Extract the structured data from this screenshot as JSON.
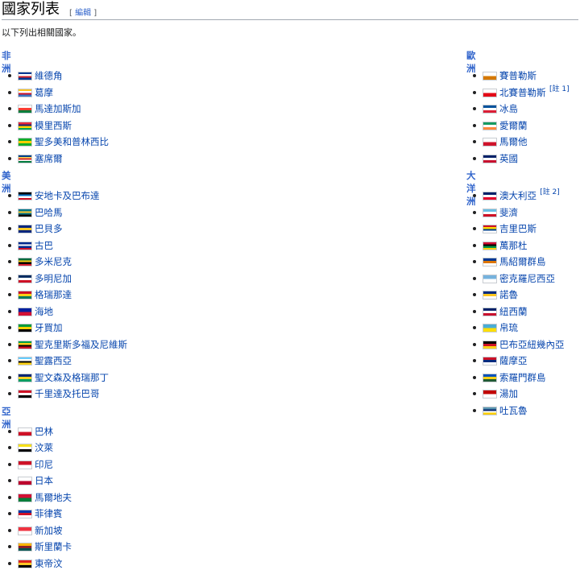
{
  "heading": {
    "title": "國家列表",
    "edit_open": "[",
    "edit_label": "編輯",
    "edit_close": "]"
  },
  "intro": "以下列出相關國家。",
  "left": [
    {
      "name": "非洲",
      "items": [
        {
          "name": "維德角",
          "flag": [
            "#003893",
            "#ffffff",
            "#cf2027",
            "#003893"
          ]
        },
        {
          "name": "葛摩",
          "flag": [
            "#ffc61e",
            "#ffffff",
            "#ce1126",
            "#3a75c4"
          ]
        },
        {
          "name": "馬達加斯加",
          "flag": [
            "#ffffff",
            "#fc3d32",
            "#007e3a"
          ]
        },
        {
          "name": "模里西斯",
          "flag": [
            "#ea2839",
            "#1a206d",
            "#ffd500",
            "#00a551"
          ]
        },
        {
          "name": "聖多美和普林西比",
          "flag": [
            "#12ad2b",
            "#ffce00",
            "#12ad2b"
          ]
        },
        {
          "name": "塞席爾",
          "flag": [
            "#003f87",
            "#fcd856",
            "#d62828",
            "#ffffff",
            "#007a3d"
          ]
        }
      ]
    },
    {
      "name": "美洲",
      "items": [
        {
          "name": "安地卡及巴布達",
          "flag": [
            "#000000",
            "#0072c6",
            "#ffffff",
            "#ce1126"
          ]
        },
        {
          "name": "巴哈馬",
          "flag": [
            "#00778b",
            "#ffc72c",
            "#00778b",
            "#000000"
          ]
        },
        {
          "name": "巴貝多",
          "flag": [
            "#00267f",
            "#ffc726",
            "#00267f"
          ]
        },
        {
          "name": "古巴",
          "flag": [
            "#002a8f",
            "#ffffff",
            "#002a8f",
            "#cf142b"
          ]
        },
        {
          "name": "多米尼克",
          "flag": [
            "#006b3f",
            "#fcd116",
            "#000000",
            "#d41c30"
          ]
        },
        {
          "name": "多明尼加",
          "flag": [
            "#002d62",
            "#ffffff",
            "#ce1126"
          ]
        },
        {
          "name": "格瑞那達",
          "flag": [
            "#ce1126",
            "#fcd116",
            "#007a5e"
          ]
        },
        {
          "name": "海地",
          "flag": [
            "#00209f",
            "#d21034"
          ]
        },
        {
          "name": "牙買加",
          "flag": [
            "#009b3a",
            "#fed100",
            "#000000"
          ]
        },
        {
          "name": "聖克里斯多福及尼維斯",
          "flag": [
            "#009e49",
            "#fcd116",
            "#000000",
            "#ce1126"
          ]
        },
        {
          "name": "聖露西亞",
          "flag": [
            "#66ccff",
            "#ffffff",
            "#000000",
            "#fcd116"
          ]
        },
        {
          "name": "聖文森及格瑞那丁",
          "flag": [
            "#002674",
            "#fcd022",
            "#009e60"
          ]
        },
        {
          "name": "千里達及托巴哥",
          "flag": [
            "#ce1126",
            "#ffffff",
            "#000000"
          ]
        }
      ]
    },
    {
      "name": "亞洲",
      "items": [
        {
          "name": "巴林",
          "flag": [
            "#ffffff",
            "#ce1126"
          ]
        },
        {
          "name": "汶萊",
          "flag": [
            "#f7e017",
            "#ffffff",
            "#000000"
          ]
        },
        {
          "name": "印尼",
          "flag": [
            "#ce1126",
            "#ffffff"
          ]
        },
        {
          "name": "日本",
          "flag": [
            "#ffffff",
            "#bc002d"
          ]
        },
        {
          "name": "馬爾地夫",
          "flag": [
            "#d21034",
            "#007e3a"
          ]
        },
        {
          "name": "菲律賓",
          "flag": [
            "#0038a8",
            "#ce1126",
            "#ffffff"
          ]
        },
        {
          "name": "新加坡",
          "flag": [
            "#ef3340",
            "#ffffff"
          ]
        },
        {
          "name": "斯里蘭卡",
          "flag": [
            "#ffb700",
            "#8d2029",
            "#00534e"
          ]
        },
        {
          "name": "東帝汶",
          "flag": [
            "#dc241f",
            "#ffc726",
            "#000000"
          ]
        }
      ]
    }
  ],
  "right": [
    {
      "name": "歐洲",
      "items": [
        {
          "name": "賽普勒斯",
          "flag": [
            "#ffffff",
            "#d57800"
          ]
        },
        {
          "name": "北賽普勒斯",
          "note": "[註 1]",
          "flag": [
            "#ffffff",
            "#e30a17"
          ]
        },
        {
          "name": "冰島",
          "flag": [
            "#02529c",
            "#ffffff",
            "#dc1e35"
          ]
        },
        {
          "name": "愛爾蘭",
          "flag": [
            "#169b62",
            "#ffffff",
            "#ff883e"
          ]
        },
        {
          "name": "馬爾他",
          "flag": [
            "#ffffff",
            "#cf142b"
          ]
        },
        {
          "name": "英國",
          "flag": [
            "#012169",
            "#ffffff",
            "#c8102e"
          ]
        }
      ]
    },
    {
      "name": "大洋洲",
      "items": [
        {
          "name": "澳大利亞",
          "note": "[註 2]",
          "flag": [
            "#012169",
            "#ffffff",
            "#e4002b"
          ]
        },
        {
          "name": "斐濟",
          "flag": [
            "#68bfe5",
            "#ffffff",
            "#ce1126"
          ]
        },
        {
          "name": "吉里巴斯",
          "flag": [
            "#ce1126",
            "#ffd700",
            "#003f87",
            "#ffffff"
          ]
        },
        {
          "name": "萬那杜",
          "flag": [
            "#d21034",
            "#000000",
            "#009543",
            "#fdce12"
          ]
        },
        {
          "name": "馬紹爾群島",
          "flag": [
            "#003893",
            "#dd7500",
            "#ffffff"
          ]
        },
        {
          "name": "密克羅尼西亞",
          "flag": [
            "#75b2dd",
            "#ffffff"
          ]
        },
        {
          "name": "諾魯",
          "flag": [
            "#002b7f",
            "#ffc61e",
            "#ffffff"
          ]
        },
        {
          "name": "紐西蘭",
          "flag": [
            "#012169",
            "#ffffff",
            "#c8102e"
          ]
        },
        {
          "name": "帛琉",
          "flag": [
            "#4aadd6",
            "#ffde00"
          ]
        },
        {
          "name": "巴布亞紐幾內亞",
          "flag": [
            "#000000",
            "#ce1126",
            "#fcd116"
          ]
        },
        {
          "name": "薩摩亞",
          "flag": [
            "#ce1126",
            "#002b7f",
            "#ffffff"
          ]
        },
        {
          "name": "索羅門群島",
          "flag": [
            "#0051ba",
            "#fcd116",
            "#215b33"
          ]
        },
        {
          "name": "湯加",
          "flag": [
            "#c10000",
            "#ffffff"
          ]
        },
        {
          "name": "吐瓦魯",
          "flag": [
            "#5b97b1",
            "#012169",
            "#ffffff",
            "#ffce00"
          ]
        }
      ]
    }
  ],
  "colors": {
    "link": "#0645ad",
    "section": "#3366cc",
    "border": "#a2a9b1"
  }
}
